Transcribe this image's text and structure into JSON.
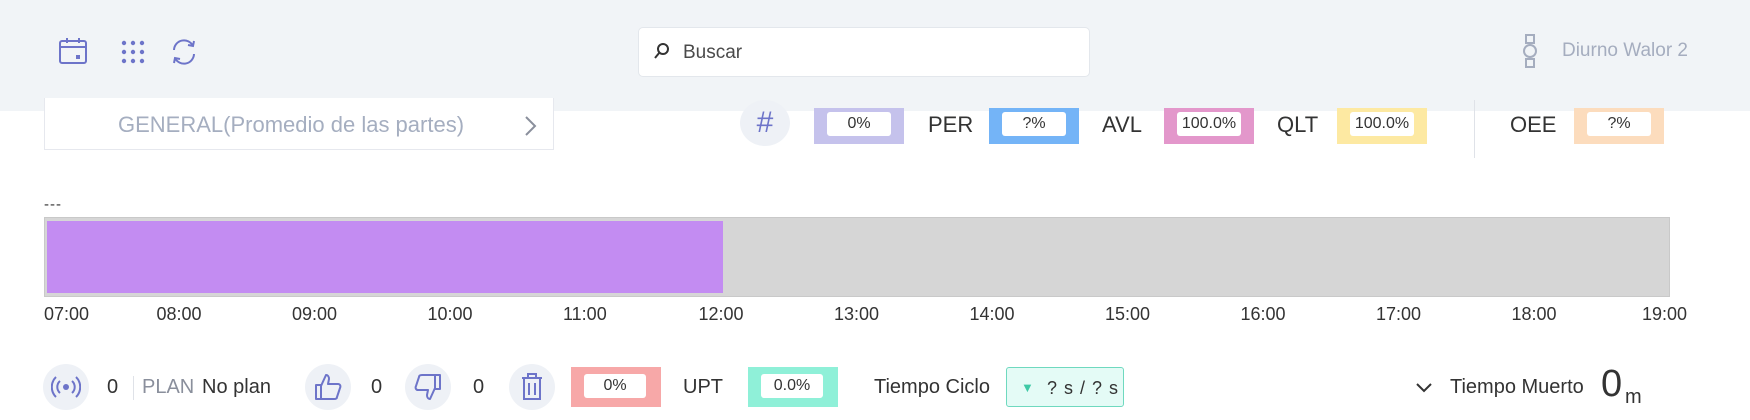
{
  "header": {
    "icons": [
      "calendar-icon",
      "grid-icon",
      "refresh-icon",
      "watch-icon"
    ],
    "search_placeholder": "Buscar",
    "user_label": "Diurno Walor 2"
  },
  "selector": {
    "label": "GENERAL(Promedio de las partes)"
  },
  "metrics": {
    "count_pct": "0%",
    "per_label": "PER",
    "per_value": "?%",
    "avl_label": "AVL",
    "avl_value": "100.0%",
    "qlt_label": "QLT",
    "qlt_value": "100.0%",
    "oee_label": "OEE",
    "oee_value": "?%",
    "colors": {
      "count": "#c5c2ec",
      "per": "#74b4f7",
      "avl": "#e397cb",
      "qlt": "#fde9a2",
      "oee": "#fcdcbd"
    }
  },
  "timeline": {
    "label": "---",
    "ticks": [
      "07:00",
      "08:00",
      "09:00",
      "10:00",
      "11:00",
      "12:00",
      "13:00",
      "14:00",
      "15:00",
      "16:00",
      "17:00",
      "18:00",
      "19:00"
    ],
    "progress_start": "07:00",
    "progress_end": "12:00",
    "bar_color": "#c38cf2"
  },
  "footer": {
    "signal_count": "0",
    "plan_label": "PLAN",
    "plan_value": "No plan",
    "good_count": "0",
    "bad_count": "0",
    "scrap_pct": "0%",
    "upt_label": "UPT",
    "upt_value": "0.0%",
    "cycle_label": "Tiempo Ciclo",
    "cycle_value": "? s / ? s",
    "dead_label": "Tiempo Muerto",
    "dead_value": "0",
    "dead_unit": "m",
    "colors": {
      "scrap": "#f7a8a8",
      "upt": "#8ff0d8"
    }
  }
}
